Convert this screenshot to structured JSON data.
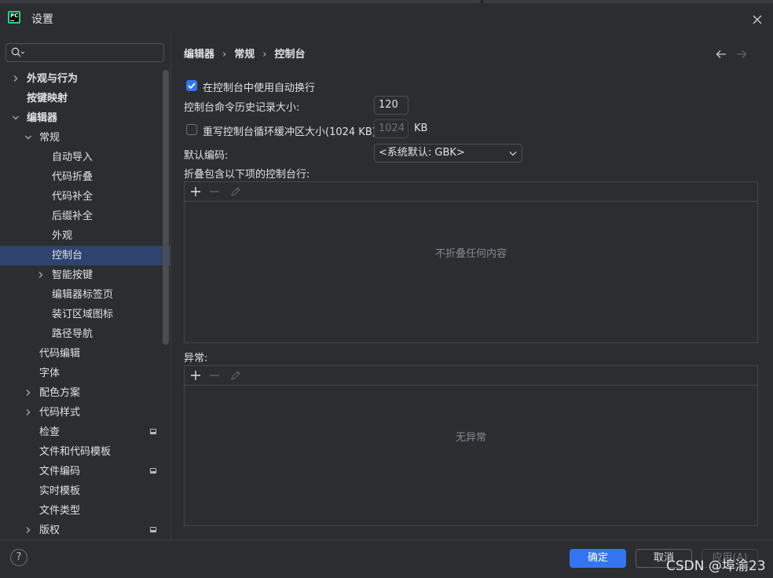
{
  "window": {
    "title": "设置"
  },
  "sidebar": {
    "search_placeholder": "",
    "tree": [
      {
        "label": "外观与行为",
        "arrow": "right",
        "indent": 0,
        "bold": true
      },
      {
        "label": "按键映射",
        "arrow": null,
        "indent": 0,
        "bold": true
      },
      {
        "label": "编辑器",
        "arrow": "down",
        "indent": 0,
        "bold": true
      },
      {
        "label": "常规",
        "arrow": "down",
        "indent": 1
      },
      {
        "label": "自动导入",
        "arrow": null,
        "indent": 2
      },
      {
        "label": "代码折叠",
        "arrow": null,
        "indent": 2
      },
      {
        "label": "代码补全",
        "arrow": null,
        "indent": 2
      },
      {
        "label": "后缀补全",
        "arrow": null,
        "indent": 2
      },
      {
        "label": "外观",
        "arrow": null,
        "indent": 2
      },
      {
        "label": "控制台",
        "arrow": null,
        "indent": 2,
        "selected": true
      },
      {
        "label": "智能按键",
        "arrow": "right",
        "indent": 2
      },
      {
        "label": "编辑器标签页",
        "arrow": null,
        "indent": 2
      },
      {
        "label": "装订区域图标",
        "arrow": null,
        "indent": 2
      },
      {
        "label": "路径导航",
        "arrow": null,
        "indent": 2
      },
      {
        "label": "代码编辑",
        "arrow": null,
        "indent": 1
      },
      {
        "label": "字体",
        "arrow": null,
        "indent": 1
      },
      {
        "label": "配色方案",
        "arrow": "right",
        "indent": 1
      },
      {
        "label": "代码样式",
        "arrow": "right",
        "indent": 1
      },
      {
        "label": "检查",
        "arrow": null,
        "indent": 1,
        "badge": true
      },
      {
        "label": "文件和代码模板",
        "arrow": null,
        "indent": 1
      },
      {
        "label": "文件编码",
        "arrow": null,
        "indent": 1,
        "badge": true
      },
      {
        "label": "实时模板",
        "arrow": null,
        "indent": 1
      },
      {
        "label": "文件类型",
        "arrow": null,
        "indent": 1
      },
      {
        "label": "版权",
        "arrow": "right",
        "indent": 1,
        "badge": true
      }
    ]
  },
  "breadcrumb": {
    "items": [
      "编辑器",
      "常规",
      "控制台"
    ],
    "separator": "›"
  },
  "settings": {
    "soft_wrap_label": "在控制台中使用自动换行",
    "soft_wrap_checked": true,
    "history_label": "控制台命令历史记录大小:",
    "history_value": "120",
    "cycle_buffer_label": "重写控制台循环缓冲区大小(1024 KB)",
    "cycle_buffer_checked": false,
    "cycle_buffer_value": "1024",
    "cycle_buffer_unit": "KB",
    "encoding_label": "默认编码:",
    "encoding_value": "<系统默认: GBK>",
    "fold_label": "折叠包含以下项的控制台行:",
    "fold_empty": "不折叠任何内容",
    "exceptions_label": "异常:",
    "exceptions_empty": "无异常"
  },
  "footer": {
    "help": "?",
    "ok": "确定",
    "cancel": "取消",
    "apply": "应用(A)"
  },
  "watermark": "CSDN @埠渝23",
  "colors": {
    "accent": "#3574f0",
    "selection": "#2e436e",
    "background": "#2b2d30"
  }
}
